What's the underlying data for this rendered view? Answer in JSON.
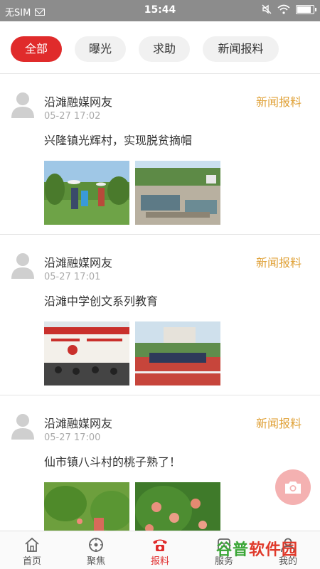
{
  "status_bar": {
    "carrier": "无SIM",
    "time": "15:44"
  },
  "filters": [
    {
      "label": "全部",
      "active": true
    },
    {
      "label": "曝光",
      "active": false
    },
    {
      "label": "求助",
      "active": false
    },
    {
      "label": "新闻报料",
      "active": false
    }
  ],
  "posts": [
    {
      "author": "沿滩融媒网友",
      "time": "05-27 17:02",
      "tag": "新闻报料",
      "content": "兴隆镇光辉村，实现脱贫摘帽"
    },
    {
      "author": "沿滩融媒网友",
      "time": "05-27 17:01",
      "tag": "新闻报料",
      "content": "沿滩中学创文系列教育"
    },
    {
      "author": "沿滩融媒网友",
      "time": "05-27 17:00",
      "tag": "新闻报料",
      "content": "仙市镇八斗村的桃子熟了！"
    }
  ],
  "tabbar": [
    {
      "label": "首页",
      "icon": "home-icon",
      "active": false
    },
    {
      "label": "聚焦",
      "icon": "focus-icon",
      "active": false
    },
    {
      "label": "报料",
      "icon": "phone-icon",
      "active": true
    },
    {
      "label": "服务",
      "icon": "service-icon",
      "active": false
    },
    {
      "label": "我的",
      "icon": "user-icon",
      "active": false
    }
  ],
  "watermark": {
    "part1": "谷普",
    "part2": "软件园"
  },
  "colors": {
    "accent": "#e02b2b",
    "tag": "#e0a239",
    "statusbar": "#8c8c8c"
  }
}
